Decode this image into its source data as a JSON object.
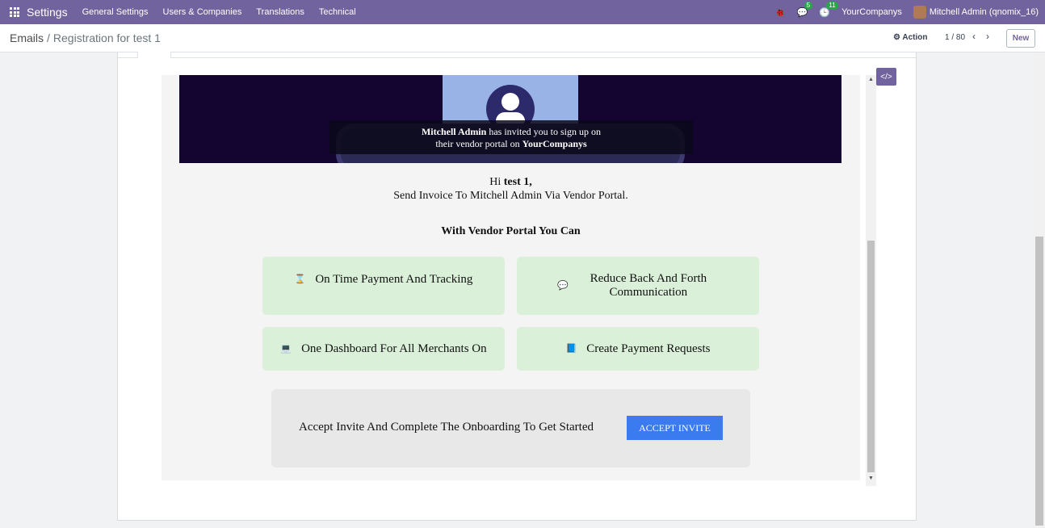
{
  "navbar": {
    "app_name": "Settings",
    "menu": [
      "General Settings",
      "Users & Companies",
      "Translations",
      "Technical"
    ],
    "messages_count": "5",
    "activities_count": "11",
    "company": "YourCompanys",
    "user": "Mitchell Admin (qnomix_16)"
  },
  "control": {
    "breadcrumb_root": "Emails",
    "breadcrumb_separator": "/",
    "breadcrumb_current": "Registration for test 1",
    "action_label": "Action",
    "pager": "1 / 80",
    "new_label": "New"
  },
  "email": {
    "hero": {
      "inviter": "Mitchell Admin",
      "line1_rest": " has invited you to sign up on",
      "line2_prefix": "their vendor portal on ",
      "company": "YourCompanys"
    },
    "greeting_prefix": "Hi ",
    "greeting_name": "test 1,",
    "intro": "Send Invoice To Mitchell Admin Via Vendor Portal.",
    "features_title": "With Vendor Portal You Can",
    "features": [
      {
        "icon": "hourglass-icon",
        "glyph": "⌛",
        "label": "On Time Payment And Tracking"
      },
      {
        "icon": "comments-icon",
        "glyph": "💬",
        "label": "Reduce Back And Forth Communication"
      },
      {
        "icon": "laptop-icon",
        "glyph": "💻",
        "label": "One Dashboard For All Merchants On"
      },
      {
        "icon": "book-icon",
        "glyph": "📘",
        "label": "Create Payment Requests"
      }
    ],
    "cta_text": "Accept Invite And Complete The Onboarding To Get Started",
    "cta_button": "ACCEPT INVITE"
  },
  "colors": {
    "navbar": "#71639e",
    "card_bg": "#daf0d9",
    "cta_button": "#3a7bf0"
  }
}
